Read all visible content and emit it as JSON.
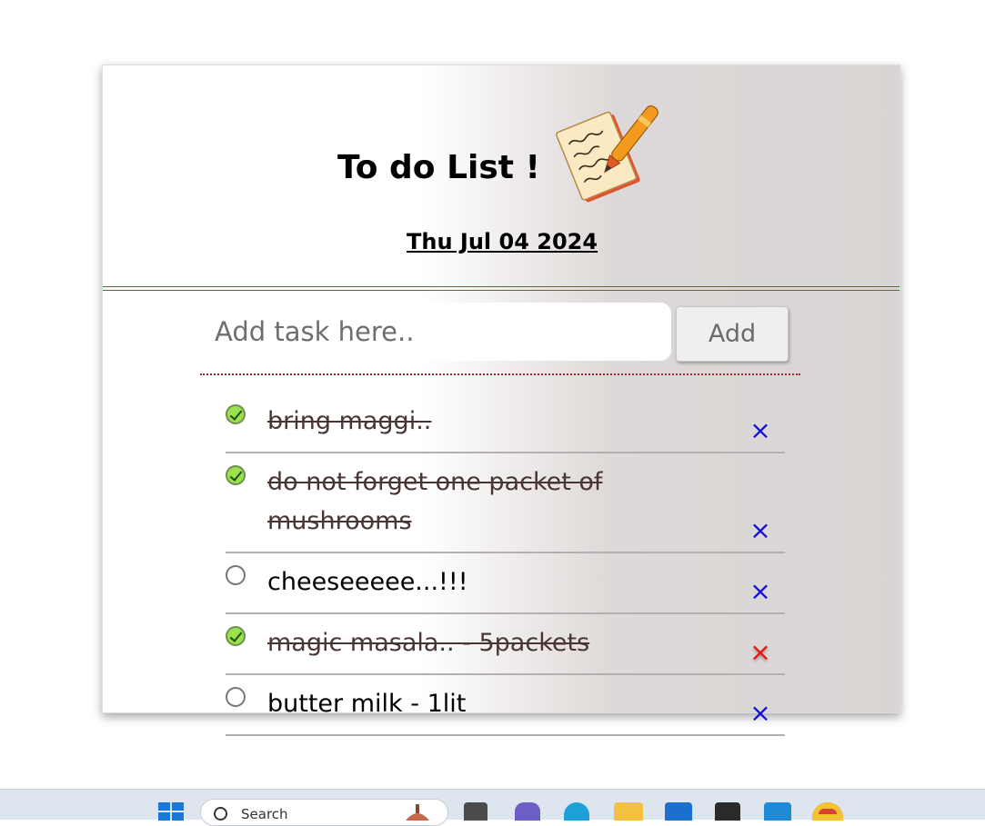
{
  "header": {
    "title": "To do List !",
    "date": "Thu Jul 04 2024"
  },
  "input": {
    "placeholder": "Add task here..",
    "value": ""
  },
  "add_button_label": "Add",
  "tasks": [
    {
      "text": "bring maggi..",
      "done": true
    },
    {
      "text": "do not forget one packet of mushrooms",
      "done": true
    },
    {
      "text": "cheeseeeee...!!!",
      "done": false
    },
    {
      "text": "magic masala.. - 5packets",
      "done": true
    },
    {
      "text": "butter milk - 1lit",
      "done": false
    }
  ],
  "delete_glyph": "×",
  "colors": {
    "delete": "#1010dd",
    "delete_hover": "#ee1111",
    "checked": "#9be04d",
    "separator": "#b93a3a"
  },
  "taskbar": {
    "search_label": "Search",
    "icons": [
      "windows-start-icon",
      "search-icon",
      "task-view-icon",
      "teams-icon",
      "edge-icon",
      "file-explorer-icon",
      "mail-icon",
      "notion-icon",
      "vscode-icon",
      "chrome-icon"
    ]
  }
}
